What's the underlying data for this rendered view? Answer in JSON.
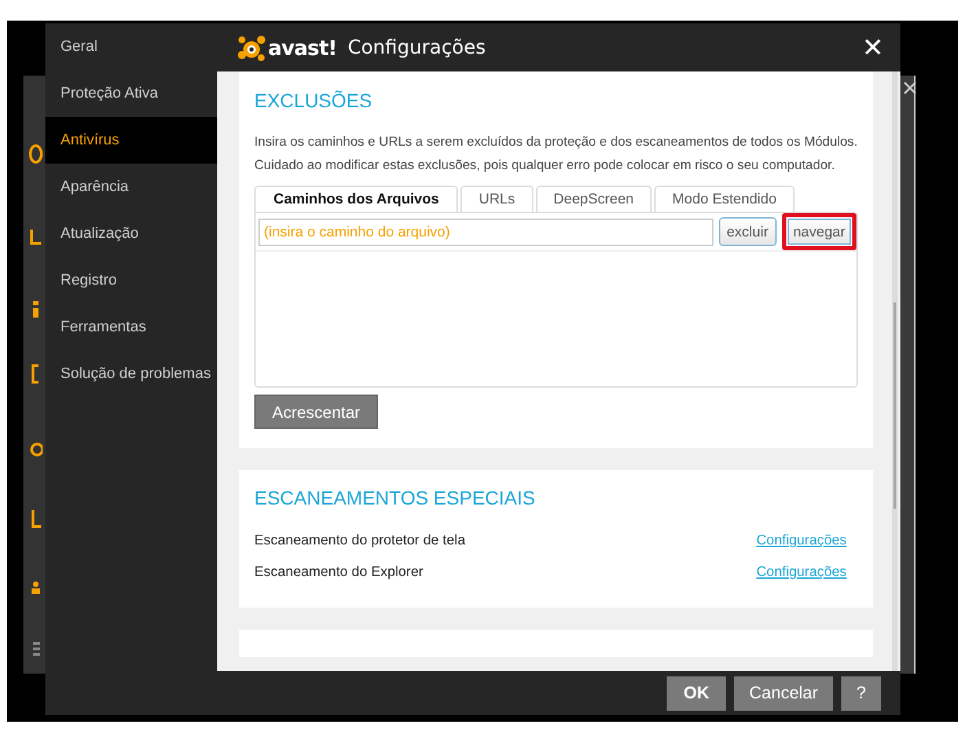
{
  "sidebar": {
    "items": [
      {
        "label": "Geral",
        "selected": false
      },
      {
        "label": "Proteção Ativa",
        "selected": false
      },
      {
        "label": "Antivírus",
        "selected": true
      },
      {
        "label": "Aparência",
        "selected": false
      },
      {
        "label": "Atualização",
        "selected": false
      },
      {
        "label": "Registro",
        "selected": false
      },
      {
        "label": "Ferramentas",
        "selected": false
      },
      {
        "label": "Solução de problemas",
        "selected": false
      }
    ]
  },
  "header": {
    "logo": "avast!",
    "title": "Configurações",
    "close": "✕"
  },
  "exclusions": {
    "title": "EXCLUSÕES",
    "description_lines": [
      "Insira os caminhos e URLs a serem excluídos da proteção e dos escaneamentos de todos os Módulos.",
      "Cuidado ao modificar estas exclusões, pois qualquer erro pode colocar em risco o seu computador."
    ],
    "tabs": [
      {
        "label": "Caminhos dos Arquivos",
        "selected": true
      },
      {
        "label": "URLs",
        "selected": false
      },
      {
        "label": "DeepScreen",
        "selected": false
      },
      {
        "label": "Modo Estendido",
        "selected": false
      }
    ],
    "path_field": {
      "placeholder": "(insira o caminho do arquivo)"
    },
    "field_buttons": [
      {
        "label": "excluir",
        "highlighted": false
      },
      {
        "label": "navegar",
        "highlighted": true
      }
    ],
    "add_button": "Acrescentar"
  },
  "special_scans": {
    "title": "ESCANEAMENTOS ESPECIAIS",
    "rows": [
      {
        "label": "Escaneamento do protetor de tela",
        "link": "Configurações"
      },
      {
        "label": "Escaneamento do Explorer",
        "link": "Configurações"
      }
    ]
  },
  "footer": {
    "buttons": [
      {
        "label": "OK",
        "kind": "primary"
      },
      {
        "label": "Cancelar",
        "kind": "normal"
      },
      {
        "label": "?",
        "kind": "help"
      }
    ]
  }
}
